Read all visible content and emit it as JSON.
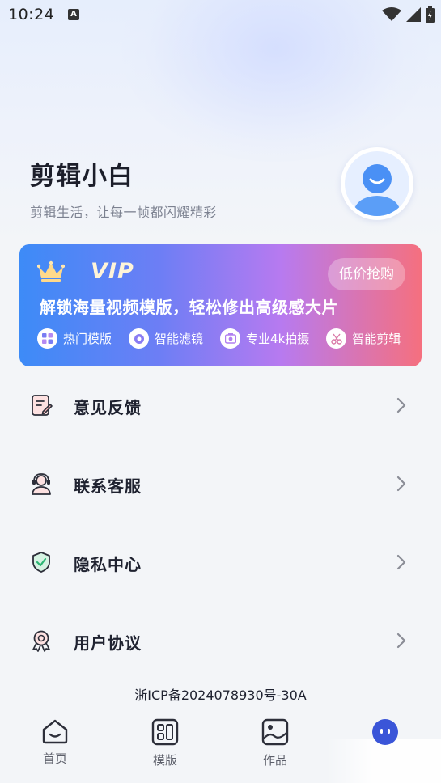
{
  "status_bar": {
    "time": "10:24",
    "notification_icon": "A",
    "icons": [
      "wifi-icon",
      "signal-icon",
      "battery-charging-icon"
    ]
  },
  "profile": {
    "name": "剪辑小白",
    "slogan": "剪辑生活，让每一帧都闪耀精彩",
    "avatar_icon": "user-avatar-icon"
  },
  "vip": {
    "title": "VIP",
    "crown_icon": "crown-icon",
    "button_label": "低价抢购",
    "headline": "解锁海量视频模版，轻松修出高级感大片",
    "features": [
      {
        "label": "热门模版",
        "icon": "template-icon"
      },
      {
        "label": "智能滤镜",
        "icon": "filter-icon"
      },
      {
        "label": "专业4k拍摄",
        "icon": "camera-icon"
      },
      {
        "label": "智能剪辑",
        "icon": "scissors-icon"
      }
    ],
    "colors": {
      "start": "#3d8bf7",
      "end": "#f5707f"
    }
  },
  "menu": [
    {
      "label": "意见反馈",
      "icon": "feedback-icon"
    },
    {
      "label": "联系客服",
      "icon": "customer-service-icon"
    },
    {
      "label": "隐私中心",
      "icon": "shield-icon"
    },
    {
      "label": "用户协议",
      "icon": "badge-icon"
    }
  ],
  "footer": {
    "icp": "浙ICP备2024078930号-30A"
  },
  "bottom_nav": [
    {
      "label": "首页",
      "icon": "home-icon"
    },
    {
      "label": "模版",
      "icon": "template-grid-icon"
    },
    {
      "label": "作品",
      "icon": "image-icon"
    },
    {
      "label": "",
      "icon": "profile-face-icon",
      "active": true
    }
  ],
  "accent_color": "#3a55d8"
}
